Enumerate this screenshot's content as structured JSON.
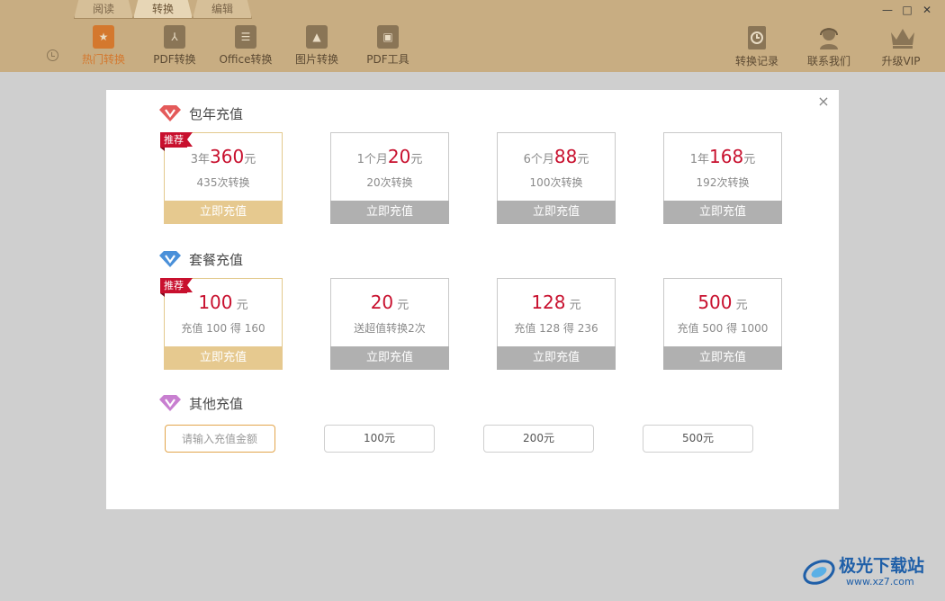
{
  "tabs": [
    "阅读",
    "转换",
    "编辑"
  ],
  "nav": {
    "items": [
      {
        "label": "热门转换"
      },
      {
        "label": "PDF转换"
      },
      {
        "label": "Office转换"
      },
      {
        "label": "图片转换"
      },
      {
        "label": "PDF工具"
      }
    ],
    "right": [
      {
        "label": "转换记录"
      },
      {
        "label": "联系我们"
      },
      {
        "label": "升级VIP"
      }
    ]
  },
  "window": {
    "minimize": "—",
    "maximize": "□",
    "close": "✕"
  },
  "dialog": {
    "close": "×",
    "annual": {
      "title": "包年充值",
      "cards": [
        {
          "badge": "推荐",
          "prefix": "3年",
          "amount": "360",
          "unit": "元",
          "desc": "435次转换",
          "button": "立即充值"
        },
        {
          "prefix": "1个月",
          "amount": "20",
          "unit": "元",
          "desc": "20次转换",
          "button": "立即充值"
        },
        {
          "prefix": "6个月",
          "amount": "88",
          "unit": "元",
          "desc": "100次转换",
          "button": "立即充值"
        },
        {
          "prefix": "1年",
          "amount": "168",
          "unit": "元",
          "desc": "192次转换",
          "button": "立即充值"
        }
      ]
    },
    "package": {
      "title": "套餐充值",
      "cards": [
        {
          "badge": "推荐",
          "amount": "100",
          "unit": " 元",
          "desc": "充值 100 得 160",
          "button": "立即充值"
        },
        {
          "amount": "20",
          "unit": " 元",
          "desc": "送超值转换2次",
          "button": "立即充值"
        },
        {
          "amount": "128",
          "unit": " 元",
          "desc": "充值 128 得 236",
          "button": "立即充值"
        },
        {
          "amount": "500",
          "unit": " 元",
          "desc": "充值 500 得 1000",
          "button": "立即充值"
        }
      ]
    },
    "other": {
      "title": "其他充值",
      "placeholder": "请输入充值金额",
      "options": [
        "100元",
        "200元",
        "500元"
      ]
    }
  },
  "watermark": {
    "name": "极光下载站",
    "url": "www.xz7.com"
  },
  "colors": {
    "toolbar": "#c8ad82",
    "accent": "#d4782e",
    "price": "#c8102e",
    "highlight": "#e6c98f"
  }
}
